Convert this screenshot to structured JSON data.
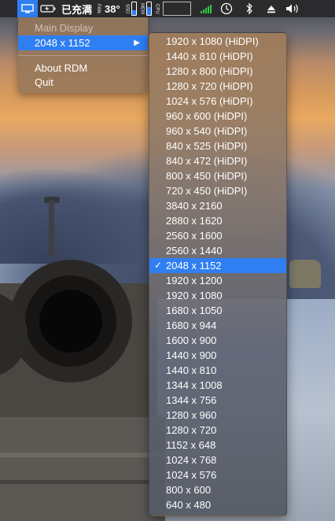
{
  "menubar": {
    "battery_status": "已充满",
    "temperature": "38°",
    "fan_label": "FAN",
    "ssd_label": "SSD",
    "mem_label": "MEM",
    "cpu_label": "CPU",
    "icons": [
      "display-icon",
      "battery-icon",
      "wifi-bars-icon",
      "time-machine-icon",
      "bluetooth-icon",
      "eject-icon",
      "volume-icon"
    ],
    "accent_color": "#2f7ff3"
  },
  "menu": {
    "items": [
      {
        "label": "Main Display",
        "disabled": true
      },
      {
        "label": "2048 x 1152",
        "has_submenu": true,
        "selected": true
      },
      {
        "label": "About RDM"
      },
      {
        "label": "Quit"
      }
    ]
  },
  "submenu": {
    "items": [
      "1920 x 1080 (HiDPI)",
      "1440 x 810 (HiDPI)",
      "1280 x 800 (HiDPI)",
      "1280 x 720 (HiDPI)",
      "1024 x 576 (HiDPI)",
      "960 x 600 (HiDPI)",
      "960 x 540 (HiDPI)",
      "840 x 525 (HiDPI)",
      "840 x 472 (HiDPI)",
      "800 x 450 (HiDPI)",
      "720 x 450 (HiDPI)",
      "3840 x 2160",
      "2880 x 1620",
      "2560 x 1600",
      "2560 x 1440",
      "2048 x 1152",
      "1920 x 1200",
      "1920 x 1080",
      "1680 x 1050",
      "1680 x 944",
      "1600 x 900",
      "1440 x 900",
      "1440 x 810",
      "1344 x 1008",
      "1344 x 756",
      "1280 x 960",
      "1280 x 720",
      "1152 x 648",
      "1024 x 768",
      "1024 x 576",
      "800 x 600",
      "640 x 480"
    ],
    "selected": "2048 x 1152",
    "check_mark": "✓"
  }
}
